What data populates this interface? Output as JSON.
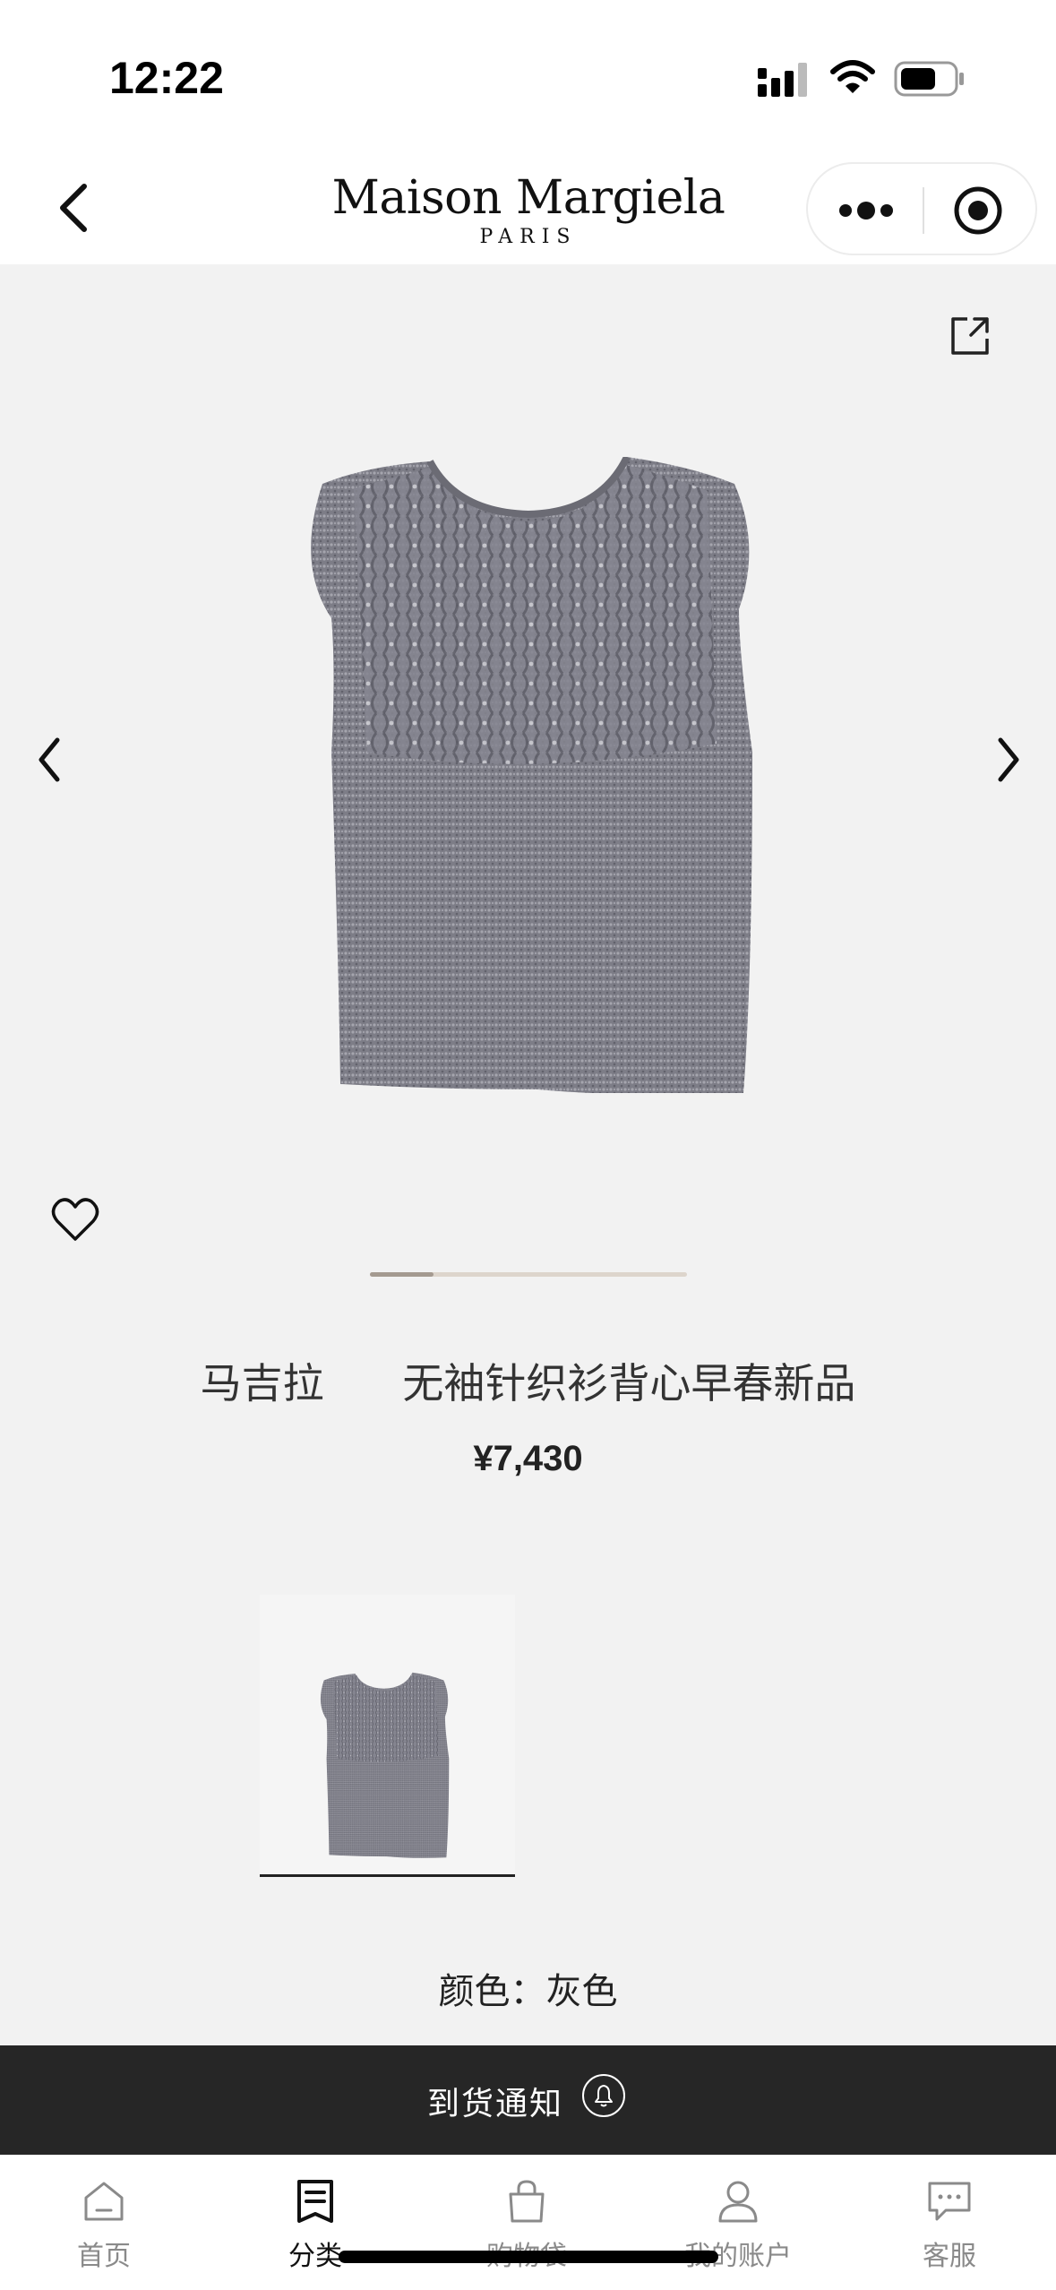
{
  "status_bar": {
    "time": "12:22"
  },
  "header": {
    "brand_name": "Maison Margiela",
    "brand_city": "PARIS"
  },
  "gallery": {
    "slide_progress": 0.2
  },
  "product": {
    "title": "马吉拉      无袖针织衫背心早春新品",
    "price": "¥7,430",
    "color_label": "颜色：",
    "color_value": "灰色"
  },
  "notify_bar": {
    "label": "到货通知"
  },
  "tabbar": {
    "items": [
      {
        "label": "首页",
        "icon": "home-icon"
      },
      {
        "label": "分类",
        "icon": "list-icon",
        "active": true
      },
      {
        "label": "购物袋",
        "icon": "bag-icon"
      },
      {
        "label": "我的账户",
        "icon": "user-icon"
      },
      {
        "label": "客服",
        "icon": "chat-icon"
      }
    ]
  },
  "colors": {
    "notify_bg": "#262626",
    "page_bg": "#f2f2f2"
  }
}
